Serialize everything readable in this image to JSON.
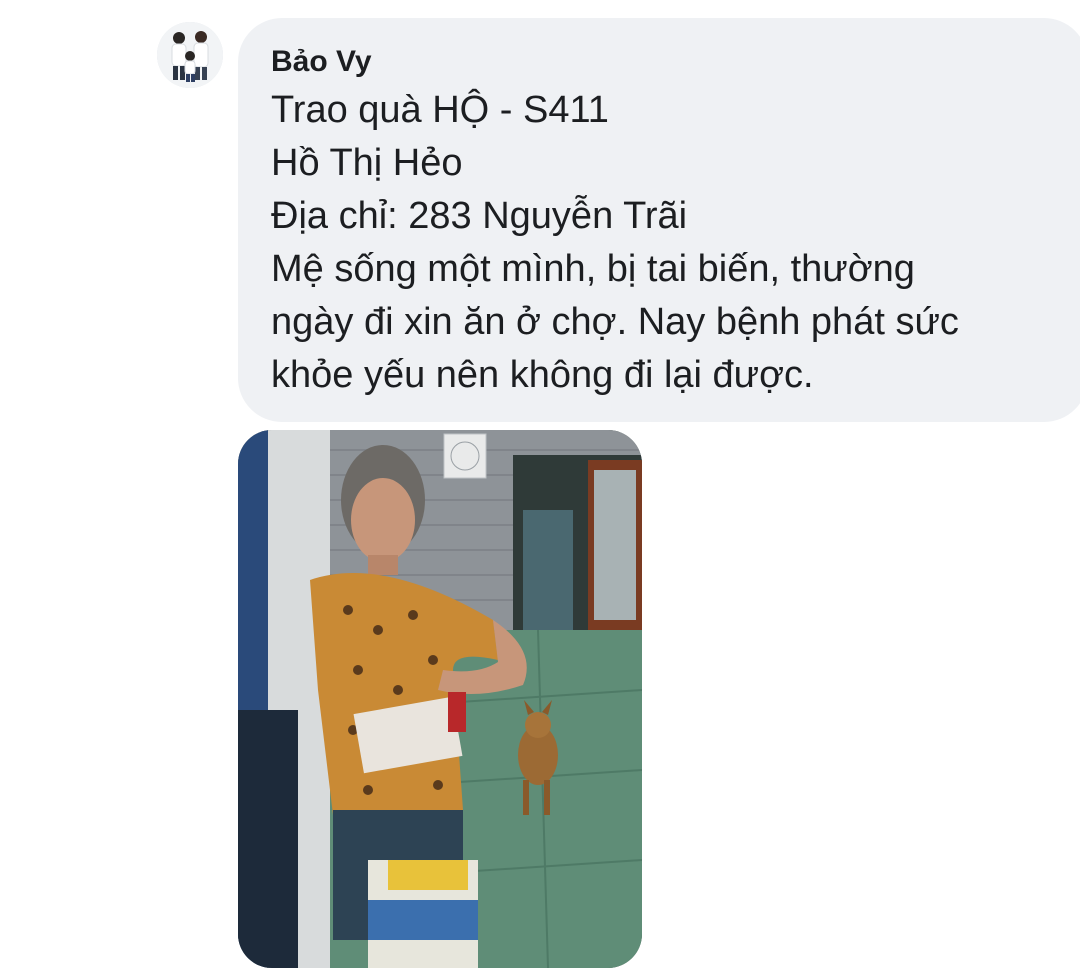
{
  "message": {
    "sender_name": "Bảo Vy",
    "lines": [
      "Trao quà HỘ - S411",
      "Hồ Thị Hẻo",
      "Địa chỉ: 283 Nguyễn Trãi",
      "Mệ sống một mình, bị tai biến, thường",
      "ngày đi xin ăn ở chợ. Nay bệnh phát sức",
      "khỏe yếu nên không đi lại được."
    ]
  },
  "avatar": {
    "icon": "family-photo-avatar"
  },
  "attachment": {
    "type": "photo",
    "icon": "photo-attachment"
  },
  "colors": {
    "bubble_bg": "#eff1f4",
    "text": "#1c1e21",
    "page_bg": "#ffffff"
  }
}
